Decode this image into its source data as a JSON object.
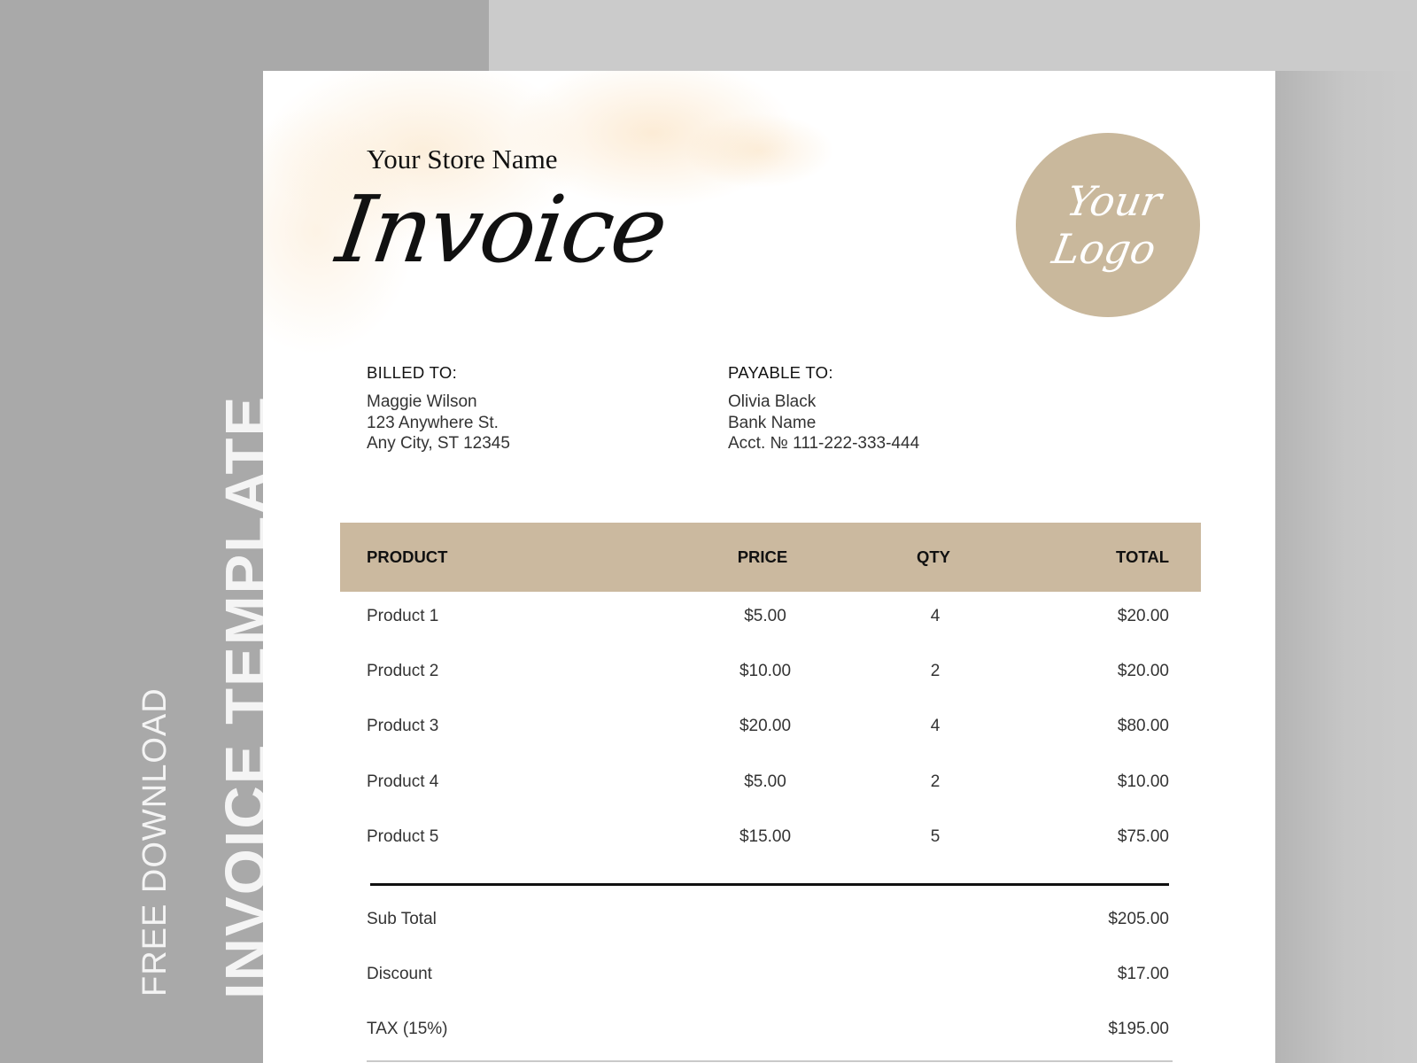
{
  "side_banner": {
    "line1": "FREE DOWNLOAD",
    "line2": "INVOICE TEMPLATE"
  },
  "colors": {
    "accent": "#cbb99f",
    "background_left": "#a9a9a9",
    "background_right": "#cbcbcb",
    "text": "#111111"
  },
  "header": {
    "store_name": "Your Store Name",
    "title": "Invoice",
    "logo_line1": "Your",
    "logo_line2": "Logo"
  },
  "billed_to": {
    "label": "BILLED TO:",
    "lines": [
      "Maggie Wilson",
      "123 Anywhere St.",
      "Any City, ST 12345"
    ]
  },
  "payable_to": {
    "label": "PAYABLE TO:",
    "lines": [
      "Olivia Black",
      "Bank Name",
      "Acct. № 111-222-333-444"
    ]
  },
  "table": {
    "columns": [
      "PRODUCT",
      "PRICE",
      "QTY",
      "TOTAL"
    ],
    "rows": [
      {
        "product": "Product 1",
        "price": "$5.00",
        "qty": "4",
        "total": "$20.00"
      },
      {
        "product": "Product 2",
        "price": "$10.00",
        "qty": "2",
        "total": "$20.00"
      },
      {
        "product": "Product 3",
        "price": "$20.00",
        "qty": "4",
        "total": "$80.00"
      },
      {
        "product": "Product 4",
        "price": "$5.00",
        "qty": "2",
        "total": "$10.00"
      },
      {
        "product": "Product 5",
        "price": "$15.00",
        "qty": "5",
        "total": "$75.00"
      }
    ]
  },
  "summary": [
    {
      "label": "Sub Total",
      "value": "$205.00"
    },
    {
      "label": "Discount",
      "value": "$17.00"
    },
    {
      "label": "TAX (15%)",
      "value": "$195.00"
    }
  ]
}
